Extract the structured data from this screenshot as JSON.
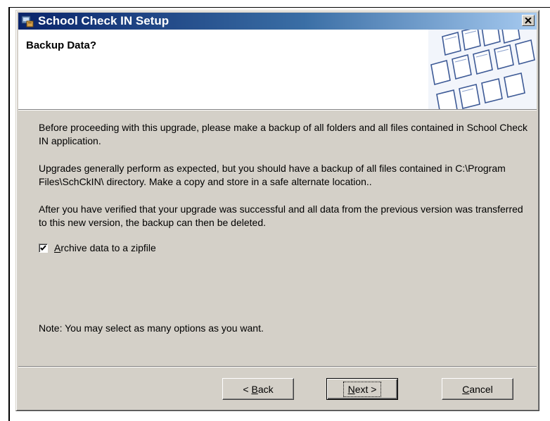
{
  "window": {
    "title": "School Check IN Setup"
  },
  "banner": {
    "heading": "Backup Data?"
  },
  "content": {
    "paragraph1": "Before proceeding with this upgrade, please make a backup of all folders and all files contained in School Check IN application.",
    "paragraph2": "Upgrades generally perform as expected, but you should have a backup of all files contained in C:\\Program Files\\SchCkIN\\  directory.  Make a copy and store in a safe alternate location..",
    "paragraph3": "After you have verified that your upgrade was successful and all data from the previous version was transferred to this new version, the backup can then be deleted.",
    "checkbox": {
      "accel": "A",
      "rest": "rchive data to a zipfile",
      "checked": true
    },
    "note": "Note: You may select as many options as you want."
  },
  "buttons": {
    "back": {
      "prefix": "< ",
      "accel": "B",
      "rest": "ack"
    },
    "next": {
      "accel": "N",
      "rest": "ext >"
    },
    "cancel": {
      "accel": "C",
      "rest": "ancel"
    }
  },
  "icons": {
    "app": "setup-icon",
    "close": "close-icon",
    "check": "checkmark-icon",
    "banner": "keyboard-keys-image"
  }
}
